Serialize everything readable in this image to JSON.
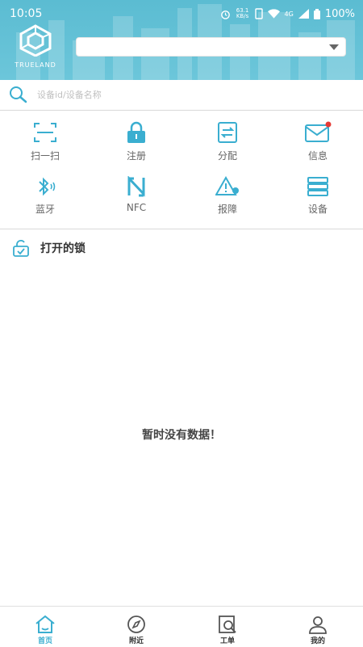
{
  "status_bar": {
    "time": "10:05",
    "speed": "63.1 KB/s",
    "network": "4G",
    "battery": "100%"
  },
  "header": {
    "brand": "TRUELAND",
    "selector_value": ""
  },
  "search": {
    "placeholder": "设备id/设备名称"
  },
  "grid": {
    "items": [
      {
        "label": "扫一扫",
        "icon": "scan-icon"
      },
      {
        "label": "注册",
        "icon": "lock-icon"
      },
      {
        "label": "分配",
        "icon": "assign-icon"
      },
      {
        "label": "信息",
        "icon": "message-icon",
        "has_badge": true
      },
      {
        "label": "蓝牙",
        "icon": "bluetooth-icon"
      },
      {
        "label": "NFC",
        "icon": "nfc-icon"
      },
      {
        "label": "报障",
        "icon": "warning-icon"
      },
      {
        "label": "设备",
        "icon": "devices-icon"
      }
    ]
  },
  "section": {
    "title": "打开的锁"
  },
  "empty_state": {
    "text": "暂时没有数据！"
  },
  "tabbar": {
    "tabs": [
      {
        "label": "首页",
        "icon": "home-icon",
        "active": true
      },
      {
        "label": "附近",
        "icon": "compass-icon",
        "active": false
      },
      {
        "label": "工单",
        "icon": "work-order-icon",
        "active": false
      },
      {
        "label": "我的",
        "icon": "user-icon",
        "active": false
      }
    ]
  },
  "colors": {
    "accent": "#3aaed0",
    "header_bg": "#5bbcd2",
    "badge": "#e53935"
  }
}
